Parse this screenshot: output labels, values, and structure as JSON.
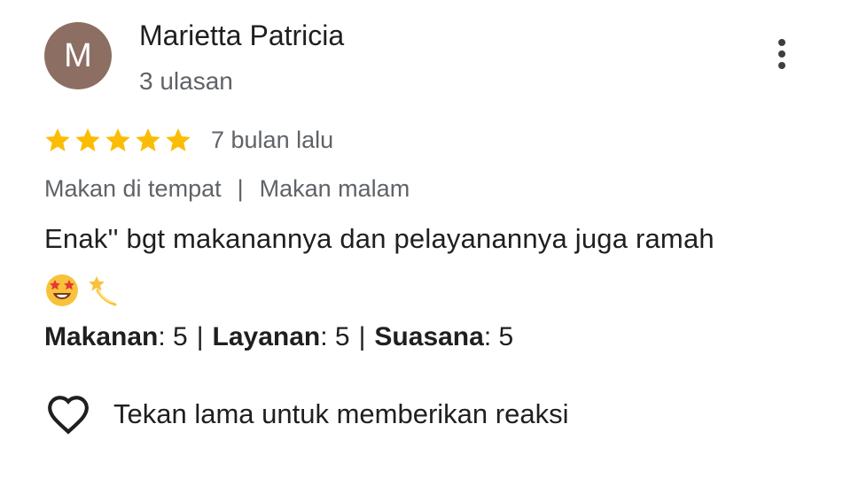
{
  "review": {
    "avatar_initial": "M",
    "avatar_color": "#8d6e63",
    "author_name": "Marietta Patricia",
    "review_count": "3 ulasan",
    "stars": 5,
    "star_color": "#fbbc04",
    "time_ago": "7 bulan lalu",
    "tag_1": "Makan di tempat",
    "tag_separator": "|",
    "tag_2": "Makan malam",
    "text": "Enak'' bgt makanannya dan pelayanannya juga ramah",
    "emoji_1": "star-struck-emoji",
    "emoji_2": "dizzy-emoji",
    "ratings": {
      "food_label": "Makanan",
      "food_value": ": 5",
      "service_label": "Layanan",
      "service_value": ": 5",
      "ambience_label": "Suasana",
      "ambience_value": ": 5",
      "separator": "|"
    },
    "reaction_prompt": "Tekan lama untuk memberikan reaksi"
  }
}
